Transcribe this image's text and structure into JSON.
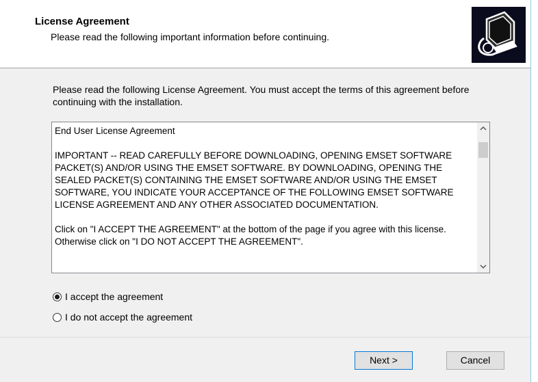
{
  "header": {
    "title": "License Agreement",
    "subtitle": "Please read the following important information before continuing."
  },
  "main": {
    "intro": "Please read the following License Agreement. You must accept the terms of this agreement before continuing with the installation.",
    "license_text": "End User License Agreement\n\nIMPORTANT -- READ CAREFULLY BEFORE DOWNLOADING, OPENING EMSET SOFTWARE PACKET(S) AND/OR USING THE EMSET SOFTWARE. BY DOWNLOADING, OPENING THE SEALED PACKET(S) CONTAINING THE EMSET SOFTWARE AND/OR USING THE EMSET SOFTWARE, YOU INDICATE YOUR ACCEPTANCE OF THE FOLLOWING EMSET SOFTWARE LICENSE AGREEMENT AND ANY OTHER ASSOCIATED DOCUMENTATION.\n\nClick on \"I ACCEPT THE AGREEMENT\" at the bottom of the page if you agree with this license. Otherwise click on \"I DO NOT ACCEPT THE AGREEMENT\".",
    "scroll_up_glyph": "^",
    "scroll_down_glyph": "v",
    "accept_label": "I accept the agreement",
    "decline_label": "I do not accept the agreement",
    "selected": "accept"
  },
  "footer": {
    "next_label": "Next >",
    "cancel_label": "Cancel"
  },
  "icons": {
    "logo": "computer-install-icon"
  },
  "colors": {
    "logo_bg": "#0b0b1e",
    "focus_border": "#0078d7"
  }
}
